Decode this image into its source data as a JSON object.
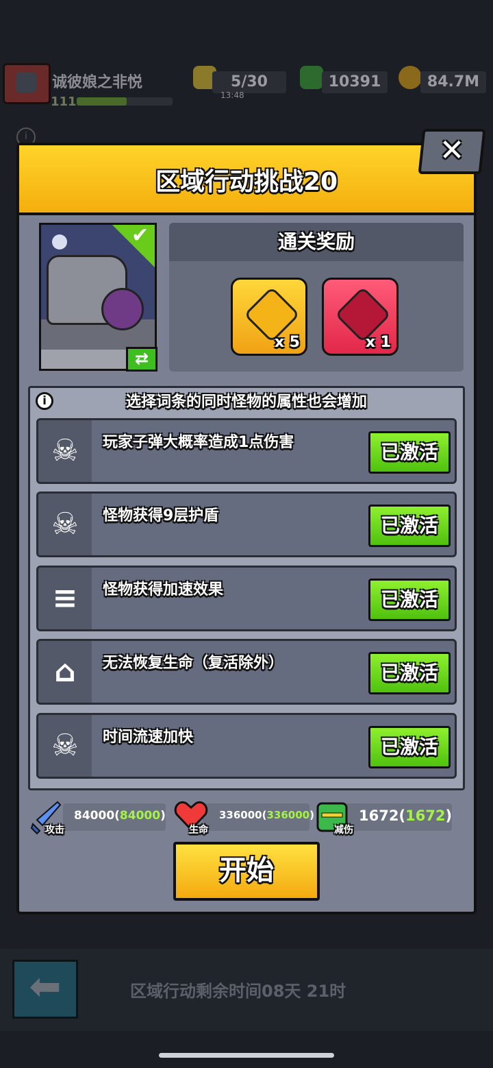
{
  "hud": {
    "player_name": "诚彼娘之非悦",
    "player_level": "111",
    "xp_progress": 0.52,
    "energy": "5/30",
    "energy_timer": "13:48",
    "gems": "10391",
    "coins": "84.7M"
  },
  "dialog": {
    "title": "区域行动挑战20",
    "close_label": "✕",
    "reward_header": "通关奖励",
    "rewards": [
      {
        "icon": "star-medal-icon",
        "qty": "x 5",
        "color": "#f4b418"
      },
      {
        "icon": "crown-badge-icon",
        "qty": "x 1",
        "color": "#e2274a"
      }
    ],
    "note": "选择词条的同时怪物的属性也会增加",
    "modifiers": [
      {
        "label": "玩家子弹大概率造成1点伤害",
        "icon": "skull-mask-icon",
        "button": "已激活"
      },
      {
        "label": "怪物获得9层护盾",
        "icon": "skull-mask-icon",
        "button": "已激活"
      },
      {
        "label": "怪物获得加速效果",
        "icon": "speed-ghost-icon",
        "button": "已激活"
      },
      {
        "label": "无法恢复生命（复活除外）",
        "icon": "no-heal-icon",
        "button": "已激活"
      },
      {
        "label": "时间流速加快",
        "icon": "skull-mask-icon",
        "button": "已激活"
      }
    ],
    "stats": {
      "attack": {
        "value": "84000(",
        "bonus": "84000",
        "close": ")",
        "tag": "攻击"
      },
      "hp": {
        "value": "336000(",
        "bonus": "336000",
        "close": ")",
        "tag": "生命"
      },
      "defense": {
        "value": "1672(",
        "bonus": "1672",
        "close": ")",
        "tag": "减伤"
      }
    },
    "start_label": "开始"
  },
  "footer": {
    "remaining_text": "区域行动剩余时间08天 21时",
    "back_label": "⬅"
  },
  "colors": {
    "header_yellow": "#f4ae0e",
    "active_green": "#4fc10e",
    "panel_grey": "#7b8192"
  }
}
